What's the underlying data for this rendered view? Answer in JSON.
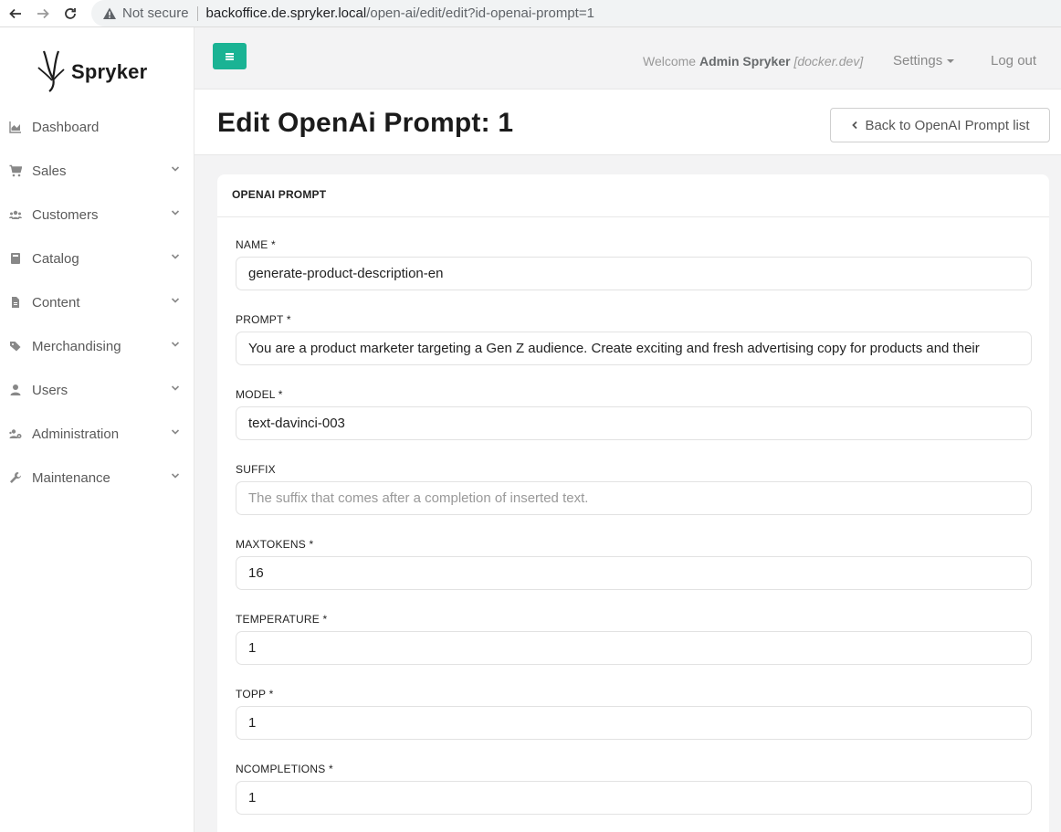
{
  "browser": {
    "security_label": "Not secure",
    "url_host": "backoffice.de.spryker.local",
    "url_path": "/open-ai/edit/edit?id-openai-prompt=1"
  },
  "brand": {
    "name": "Spryker"
  },
  "sidebar": {
    "items": [
      {
        "label": "Dashboard",
        "icon": "area-chart-icon",
        "has_children": false
      },
      {
        "label": "Sales",
        "icon": "shopping-cart-icon",
        "has_children": true
      },
      {
        "label": "Customers",
        "icon": "users-icon",
        "has_children": true
      },
      {
        "label": "Catalog",
        "icon": "book-icon",
        "has_children": true
      },
      {
        "label": "Content",
        "icon": "file-icon",
        "has_children": true
      },
      {
        "label": "Merchandising",
        "icon": "tags-icon",
        "has_children": true
      },
      {
        "label": "Users",
        "icon": "user-icon",
        "has_children": true
      },
      {
        "label": "Administration",
        "icon": "users-cog-icon",
        "has_children": true
      },
      {
        "label": "Maintenance",
        "icon": "wrench-icon",
        "has_children": true
      }
    ]
  },
  "header": {
    "welcome_prefix": "Welcome",
    "user_name": "Admin Spryker",
    "environment": "[docker.dev]",
    "settings_label": "Settings",
    "logout_label": "Log out"
  },
  "page": {
    "title": "Edit OpenAi Prompt: 1",
    "back_button_label": "Back to OpenAI Prompt list"
  },
  "form": {
    "section_title": "OPENAI PROMPT",
    "fields": [
      {
        "label": "NAME *",
        "value": "generate-product-description-en",
        "placeholder": ""
      },
      {
        "label": "PROMPT *",
        "value": "You are a product marketer targeting a Gen Z audience. Create exciting and fresh advertising copy for products and their",
        "placeholder": ""
      },
      {
        "label": "MODEL *",
        "value": "text-davinci-003",
        "placeholder": ""
      },
      {
        "label": "SUFFIX",
        "value": "",
        "placeholder": "The suffix that comes after a completion of inserted text."
      },
      {
        "label": "MAXTOKENS *",
        "value": "16",
        "placeholder": ""
      },
      {
        "label": "TEMPERATURE *",
        "value": "1",
        "placeholder": ""
      },
      {
        "label": "TOPP *",
        "value": "1",
        "placeholder": ""
      },
      {
        "label": "NCOMPLETIONS *",
        "value": "1",
        "placeholder": ""
      }
    ]
  },
  "colors": {
    "accent": "#1ab394",
    "background": "#f3f3f4"
  }
}
